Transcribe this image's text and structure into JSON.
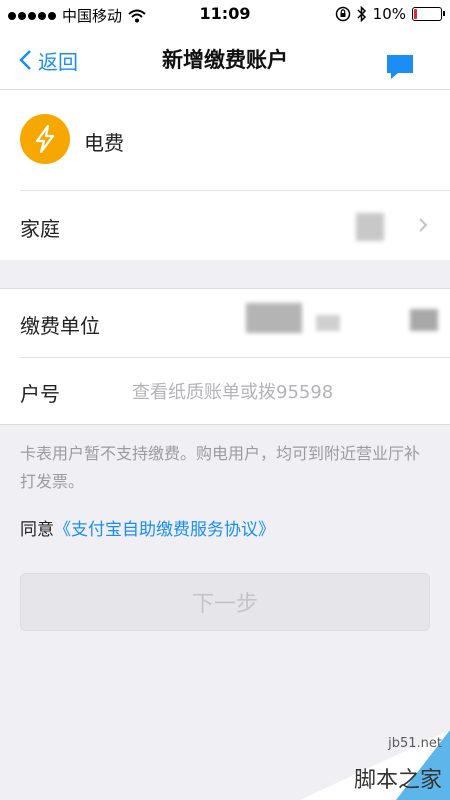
{
  "status_bar": {
    "carrier": "中国移动",
    "time": "11:09",
    "battery": "10%",
    "battery_level": 0.1,
    "battery_color": "#e0262a"
  },
  "nav": {
    "back_label": "返回",
    "title": "新增缴费账户",
    "accent_color": "#1a8ef5"
  },
  "biller": {
    "icon": "lightning-bolt-icon",
    "icon_color": "#f6a800",
    "name": "电费"
  },
  "group": {
    "label": "家庭"
  },
  "payment_unit": {
    "label": "缴费单位"
  },
  "account": {
    "label": "户号",
    "value": "",
    "placeholder": "查看纸质账单或拨95598"
  },
  "note": "卡表用户暂不支持缴费。购电用户，均可到附近营业厅补打发票。",
  "agreement": {
    "prefix": "同意",
    "link": "《支付宝自助缴费服务协议》"
  },
  "next_button": "下一步",
  "watermark": {
    "url": "jb51.net",
    "name": "脚本之家"
  }
}
